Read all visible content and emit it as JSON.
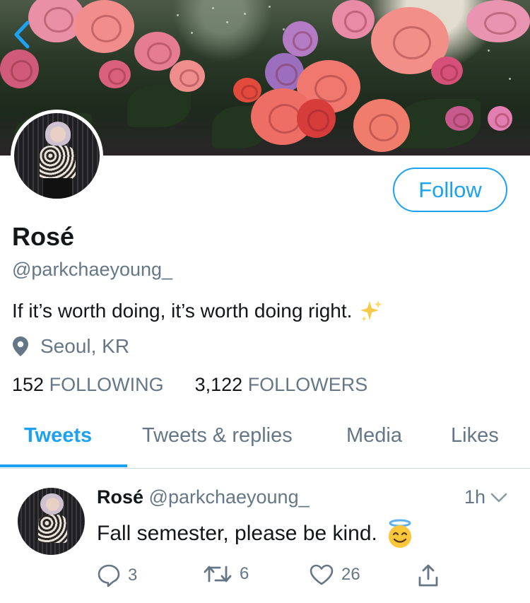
{
  "profile": {
    "display_name": "Rosé",
    "handle": "@parkchaeyoung_",
    "bio": "If it’s worth doing, it’s worth doing right.",
    "bio_emoji": "sparkles-emoji",
    "location": "Seoul, KR",
    "following_count": "152",
    "following_label": "FOLLOWING",
    "followers_count": "3,122",
    "followers_label": "FOLLOWERS"
  },
  "buttons": {
    "follow_label": "Follow"
  },
  "tabs": [
    {
      "label": "Tweets",
      "active": true
    },
    {
      "label": "Tweets & replies",
      "active": false
    },
    {
      "label": "Media",
      "active": false
    },
    {
      "label": "Likes",
      "active": false
    }
  ],
  "tweet": {
    "name": "Rosé",
    "handle": "@parkchaeyoung_",
    "time": "1h",
    "text": "Fall semester, please be kind.",
    "text_emoji": "smiling-face-with-halo-emoji",
    "replies": "3",
    "retweets": "6",
    "likes": "26"
  },
  "colors": {
    "accent": "#1da1f2",
    "secondary_text": "#657786",
    "primary_text": "#14171a",
    "divider": "#ccd6dd"
  },
  "icons": [
    "back-chevron-icon",
    "location-pin-icon",
    "chevron-down-icon",
    "reply-icon",
    "retweet-icon",
    "like-icon",
    "share-icon"
  ]
}
